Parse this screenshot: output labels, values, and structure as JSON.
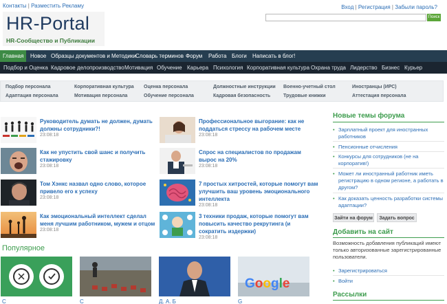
{
  "top": {
    "left_links": [
      "Контакты",
      "Разместить Рекламу"
    ],
    "right_links": [
      "Вход",
      "Регистрация",
      "Забыли пароль?"
    ],
    "separator": "|"
  },
  "logo": {
    "title": "HR-Portal",
    "subtitle": "HR-Сообщество и Публикации"
  },
  "search": {
    "placeholder": "",
    "button_label": "Поиск"
  },
  "nav_primary": [
    "Главная",
    "Новое",
    "Образцы документов и Методики",
    "Словарь терминов",
    "Форум",
    "Работа",
    "Блоги",
    "Написать в блог!"
  ],
  "nav_secondary": [
    "Подбор и Оценка",
    "Кадровое делопроизводство",
    "Мотивация",
    "Обучение",
    "Карьера",
    "Психология",
    "Корпоративная культура",
    "Охрана труда",
    "Лидерство",
    "Бизнес",
    "Курьер"
  ],
  "categories": [
    [
      "Подбор персонала",
      "Корпоративная культура",
      "Оценка персонала",
      "Должностные инструкции",
      "Военно-учетный стол",
      "Иностранцы (ИРС)"
    ],
    [
      "Адаптация персонала",
      "Мотивация персонала",
      "Обучение персонала",
      "Кадровая безопасность",
      "Трудовые книжки",
      "Аттестация персонала"
    ]
  ],
  "articles_left": [
    {
      "title": "Руководитель думать не должен, думать должны сотрудники?!",
      "time": "23:08:18"
    },
    {
      "title": "Как не упустить свой шанс и получить стажировку",
      "time": "23:08:18"
    },
    {
      "title": "Том Хэнкс назвал одно слово, которое привело его к успеху",
      "time": "23:08:18"
    },
    {
      "title": "Как эмоциональный интеллект сделал меня лучшим работником, мужем и отцом",
      "time": "23:08:18"
    }
  ],
  "articles_right": [
    {
      "title": "Профессиональное выгорание: как не поддаться стрессу на рабочем месте",
      "time": "23:08:18"
    },
    {
      "title": "Спрос на специалистов по продажам вырос на 20%",
      "time": "23:08:18"
    },
    {
      "title": "7 простых хитростей, которые помогут вам улучшить ваш уровень эмоционального интеллекта",
      "time": "23:08:18"
    },
    {
      "title": "3 техники продаж, которые помогут вам повысить качество рекрутинга (и сократить издержки)",
      "time": "23:08:18"
    }
  ],
  "popular": {
    "title": "Популярное",
    "captions": [
      "C",
      "C",
      "Д. А. Б",
      "G"
    ]
  },
  "sidebar": {
    "forum_title": "Новые темы форума",
    "forum_items": [
      "Зарплатный проект для иностранных работников",
      "Пенсионные отчисления",
      "Конкурсы для сотрудников (не на корпоратив!)",
      "Может ли иностранный работник иметь регистрацию в одном регионе, а работать в другом?",
      "Как доказать ценность разработки системы адаптации?"
    ],
    "forum_button": "Зайти на форум",
    "ask_button": "Задать вопрос",
    "add_title": "Добавить на сайт",
    "add_text": "Возможность добавления публикаций имеют только авторизованные зарегистрированные пользователи.",
    "add_links": [
      "Зарегистрироваться",
      "Войти"
    ],
    "subscribe_title": "Рассылки"
  },
  "colors": {
    "accent_green": "#3d9c4d",
    "nav_dark": "#263e50",
    "link_blue": "#2a6db5"
  }
}
